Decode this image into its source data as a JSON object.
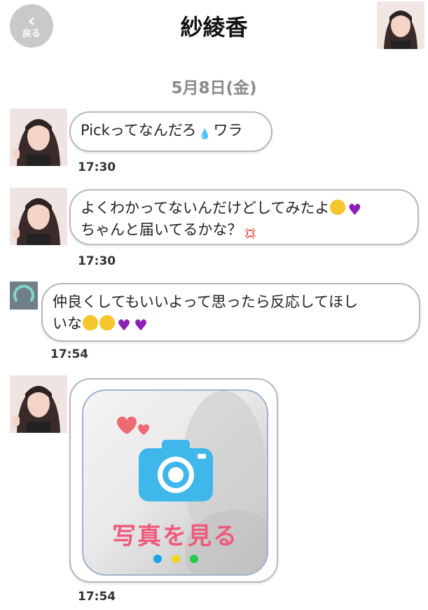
{
  "header": {
    "back_label": "戻る",
    "title": "紗綾香"
  },
  "date_separator": "5月8日(金)",
  "messages": [
    {
      "sender": "other",
      "text_parts": [
        "Pickってなんだろ",
        "ワラ"
      ],
      "time": "17:30"
    },
    {
      "sender": "other",
      "line1": "よくわかってないんだけどしてみたよ",
      "line2": "ちゃんと届いてるかな？",
      "time": "17:30"
    },
    {
      "sender": "me",
      "line1": "仲良くしてもいいよって思ったら反応してほし",
      "line2": "いな",
      "time": "17:54"
    },
    {
      "sender": "other",
      "photo_label": "写真を見る",
      "time": "17:54"
    }
  ],
  "colors": {
    "accent_pink": "#ef5a7a",
    "camera_blue": "#3fb7ea",
    "dot_blue": "#1aa4e8",
    "dot_yellow": "#f3d51a",
    "dot_green": "#22c94a",
    "heart_purple": "#8d1fb5"
  },
  "icons": [
    "back-chevron-icon",
    "camera-icon",
    "heart-icon",
    "sweat-emoji-icon",
    "grinning-face-icon",
    "smiling-face-icon"
  ]
}
